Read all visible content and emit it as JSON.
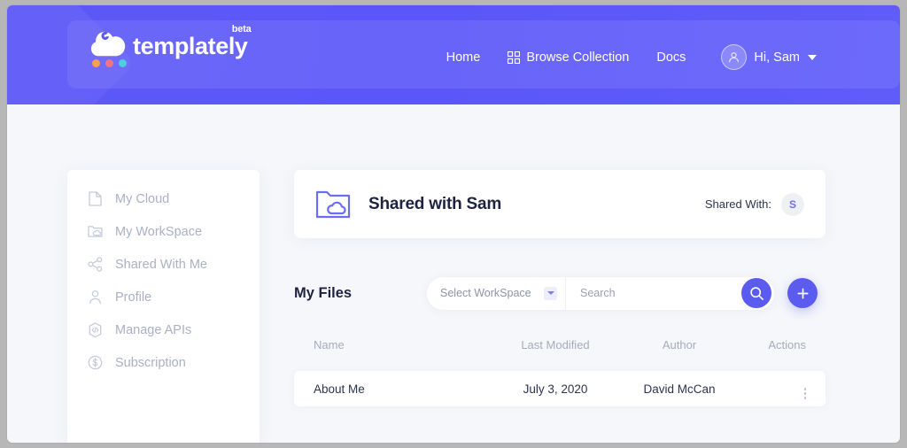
{
  "brand": {
    "wordmark": "templately",
    "badge": "beta",
    "logo_icon": "cloud-icon",
    "dot_colors": [
      "#f6a04d",
      "#f4737f",
      "#4ecfe0"
    ],
    "header_color": "#5a56f9",
    "accent_color": "#5b5bf0"
  },
  "nav": {
    "links": [
      {
        "label": "Home",
        "icon": ""
      },
      {
        "label": "Browse Collection",
        "icon": "grid-icon"
      },
      {
        "label": "Docs",
        "icon": ""
      }
    ],
    "user": {
      "greeting": "Hi, Sam",
      "avatar_icon": "user-avatar-icon",
      "caret_icon": "chevron-down-icon"
    }
  },
  "sidebar": {
    "items": [
      {
        "label": "My Cloud",
        "icon": "document-icon"
      },
      {
        "label": "My WorkSpace",
        "icon": "folder-cloud-icon"
      },
      {
        "label": "Shared With Me",
        "icon": "share-icon"
      },
      {
        "label": "Profile",
        "icon": "user-icon"
      },
      {
        "label": "Manage APIs",
        "icon": "hexagon-code-icon"
      },
      {
        "label": "Subscription",
        "icon": "dollar-circle-icon"
      }
    ]
  },
  "shared_card": {
    "icon": "folder-cloud-icon",
    "title": "Shared with Sam",
    "shared_with_label": "Shared With:",
    "shared_with_avatar": "S"
  },
  "toolbar": {
    "files_title": "My Files",
    "workspace_value": "Select WorkSpace",
    "workspace_caret_icon": "chevron-down-icon",
    "search_placeholder": "Search",
    "search_value": "",
    "search_button_icon": "search-icon",
    "add_button_icon": "plus-icon"
  },
  "table": {
    "columns": [
      "Name",
      "Last Modified",
      "Author",
      "Actions"
    ],
    "rows": [
      {
        "name": "About Me",
        "last_modified": "July 3, 2020",
        "author": "David McCan",
        "actions_icon": "more-vertical-icon"
      }
    ]
  }
}
